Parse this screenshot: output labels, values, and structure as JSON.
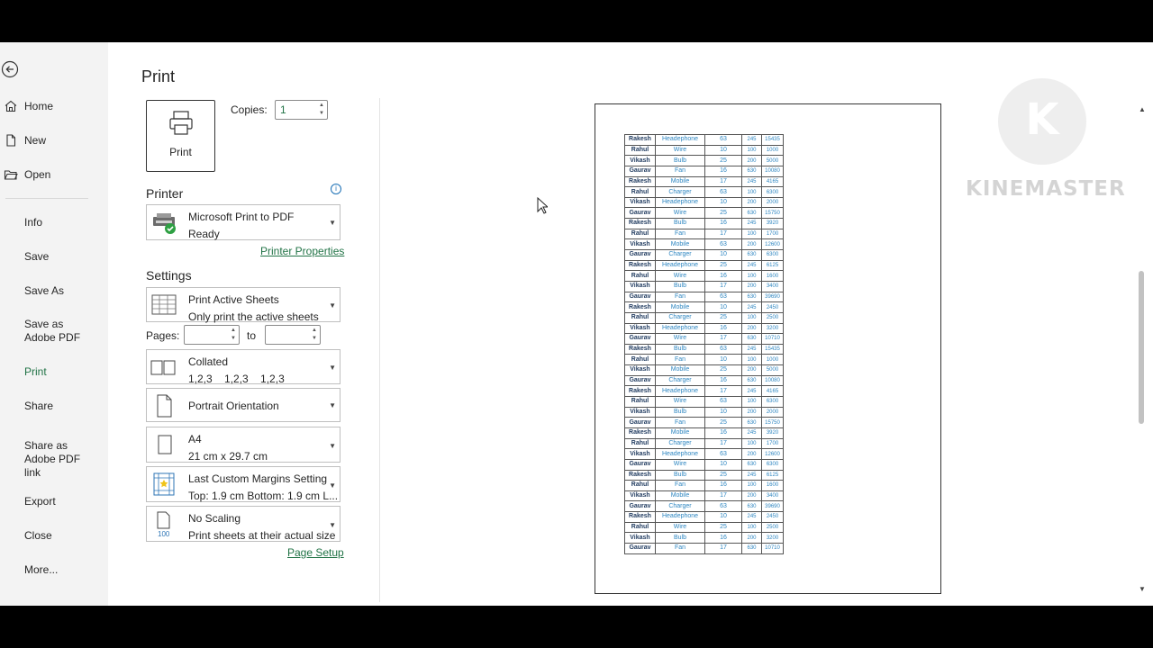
{
  "nav": {
    "items": [
      {
        "label": "Home",
        "icon": "home-icon"
      },
      {
        "label": "New",
        "icon": "new-document-icon"
      },
      {
        "label": "Open",
        "icon": "open-folder-icon"
      },
      {
        "label": "Info"
      },
      {
        "label": "Save"
      },
      {
        "label": "Save As"
      },
      {
        "label": "Save as Adobe PDF"
      },
      {
        "label": "Print",
        "active": true
      },
      {
        "label": "Share"
      },
      {
        "label": "Share as Adobe PDF link"
      },
      {
        "label": "Export"
      },
      {
        "label": "Close"
      },
      {
        "label": "More..."
      }
    ]
  },
  "print": {
    "title": "Print",
    "button_label": "Print",
    "copies_label": "Copies:",
    "copies_value": "1"
  },
  "printer": {
    "section_label": "Printer",
    "name": "Microsoft Print to PDF",
    "status": "Ready",
    "properties_link": "Printer Properties"
  },
  "settings": {
    "section_label": "Settings",
    "scope": {
      "title": "Print Active Sheets",
      "subtitle": "Only print the active sheets"
    },
    "pages_label": "Pages:",
    "pages_to_label": "to",
    "collation": {
      "title": "Collated",
      "subtitle": "1,2,3    1,2,3    1,2,3"
    },
    "orientation": {
      "title": "Portrait Orientation"
    },
    "paper": {
      "title": "A4",
      "subtitle": "21 cm x 29.7 cm"
    },
    "margins": {
      "title": "Last Custom Margins Setting",
      "subtitle": "Top: 1.9 cm Bottom: 1.9 cm L..."
    },
    "scaling": {
      "title": "No Scaling",
      "subtitle": "Print sheets at their actual size",
      "icon_text": "100"
    },
    "page_setup_link": "Page Setup"
  },
  "preview_rows": [
    [
      "Rakesh",
      "Headephone",
      "63",
      "245",
      "15435"
    ],
    [
      "Rahul",
      "Wire",
      "10",
      "100",
      "1000"
    ],
    [
      "Vikash",
      "Bulb",
      "25",
      "200",
      "5000"
    ],
    [
      "Gaurav",
      "Fan",
      "16",
      "630",
      "10080"
    ],
    [
      "Rakesh",
      "Mobile",
      "17",
      "245",
      "4165"
    ],
    [
      "Rahul",
      "Charger",
      "63",
      "100",
      "6300"
    ],
    [
      "Vikash",
      "Headephone",
      "10",
      "200",
      "2000"
    ],
    [
      "Gaurav",
      "Wire",
      "25",
      "630",
      "15750"
    ],
    [
      "Rakesh",
      "Bulb",
      "16",
      "245",
      "3920"
    ],
    [
      "Rahul",
      "Fan",
      "17",
      "100",
      "1700"
    ],
    [
      "Vikash",
      "Mobile",
      "63",
      "200",
      "12600"
    ],
    [
      "Gaurav",
      "Charger",
      "10",
      "630",
      "6300"
    ],
    [
      "Rakesh",
      "Headephone",
      "25",
      "245",
      "6125"
    ],
    [
      "Rahul",
      "Wire",
      "16",
      "100",
      "1600"
    ],
    [
      "Vikash",
      "Bulb",
      "17",
      "200",
      "3400"
    ],
    [
      "Gaurav",
      "Fan",
      "63",
      "630",
      "39690"
    ],
    [
      "Rakesh",
      "Mobile",
      "10",
      "245",
      "2450"
    ],
    [
      "Rahul",
      "Charger",
      "25",
      "100",
      "2500"
    ],
    [
      "Vikash",
      "Headephone",
      "16",
      "200",
      "3200"
    ],
    [
      "Gaurav",
      "Wire",
      "17",
      "630",
      "10710"
    ],
    [
      "Rakesh",
      "Bulb",
      "63",
      "245",
      "15435"
    ],
    [
      "Rahul",
      "Fan",
      "10",
      "100",
      "1000"
    ],
    [
      "Vikash",
      "Mobile",
      "25",
      "200",
      "5000"
    ],
    [
      "Gaurav",
      "Charger",
      "16",
      "630",
      "10080"
    ],
    [
      "Rakesh",
      "Headephone",
      "17",
      "245",
      "4165"
    ],
    [
      "Rahul",
      "Wire",
      "63",
      "100",
      "6300"
    ],
    [
      "Vikash",
      "Bulb",
      "10",
      "200",
      "2000"
    ],
    [
      "Gaurav",
      "Fan",
      "25",
      "630",
      "15750"
    ],
    [
      "Rakesh",
      "Mobile",
      "16",
      "245",
      "3920"
    ],
    [
      "Rahul",
      "Charger",
      "17",
      "100",
      "1700"
    ],
    [
      "Vikash",
      "Headephone",
      "63",
      "200",
      "12600"
    ],
    [
      "Gaurav",
      "Wire",
      "10",
      "630",
      "6300"
    ],
    [
      "Rakesh",
      "Bulb",
      "25",
      "245",
      "6125"
    ],
    [
      "Rahul",
      "Fan",
      "16",
      "100",
      "1600"
    ],
    [
      "Vikash",
      "Mobile",
      "17",
      "200",
      "3400"
    ],
    [
      "Gaurav",
      "Charger",
      "63",
      "630",
      "39690"
    ],
    [
      "Rakesh",
      "Headephone",
      "10",
      "245",
      "2450"
    ],
    [
      "Rahul",
      "Wire",
      "25",
      "100",
      "2500"
    ],
    [
      "Vikash",
      "Bulb",
      "16",
      "200",
      "3200"
    ],
    [
      "Gaurav",
      "Fan",
      "17",
      "630",
      "10710"
    ]
  ],
  "watermark": {
    "logo_letter": "K",
    "text": "KINEMASTER"
  },
  "colors": {
    "accent": "#217346",
    "link": "#217346",
    "cell_text": "#2e86c1",
    "nav_bg": "#f3f3f3"
  }
}
